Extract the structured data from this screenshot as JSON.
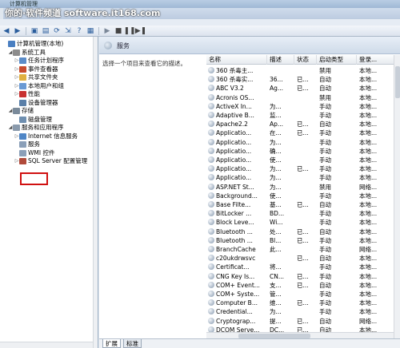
{
  "window": {
    "title": "计算机管理"
  },
  "watermark": "你的·软件频道 software.it168.com",
  "toolbar": {
    "buttons": [
      "back-arrow-icon",
      "forward-arrow-icon",
      "up-folder-icon",
      "console-tree-icon",
      "refresh-icon",
      "export-icon",
      "help-icon",
      "properties-icon",
      "play-icon",
      "stop-icon",
      "pause-icon",
      "restart-icon"
    ]
  },
  "tree": {
    "items": [
      {
        "label": "计算机管理(本地)",
        "level": 0,
        "expander": "",
        "icon": "computer-icon",
        "color": "#4a7fc1"
      },
      {
        "label": "系统工具",
        "level": 1,
        "expander": "◢",
        "icon": "tools-icon",
        "color": "#8c8c8c"
      },
      {
        "label": "任务计划程序",
        "level": 2,
        "expander": "▷",
        "icon": "clock-icon",
        "color": "#5b8cc8"
      },
      {
        "label": "事件查看器",
        "level": 2,
        "expander": "▷",
        "icon": "event-viewer-icon",
        "color": "#c84c2e"
      },
      {
        "label": "共享文件夹",
        "level": 2,
        "expander": "▷",
        "icon": "shared-folder-icon",
        "color": "#e0b040"
      },
      {
        "label": "本地用户和组",
        "level": 2,
        "expander": "▷",
        "icon": "users-icon",
        "color": "#6a9ad4"
      },
      {
        "label": "性能",
        "level": 2,
        "expander": "▷",
        "icon": "performance-icon",
        "color": "#c83030"
      },
      {
        "label": "设备管理器",
        "level": 2,
        "expander": "",
        "icon": "device-manager-icon",
        "color": "#5a7fa8"
      },
      {
        "label": "存储",
        "level": 1,
        "expander": "◢",
        "icon": "storage-icon",
        "color": "#7a8a9a"
      },
      {
        "label": "磁盘管理",
        "level": 2,
        "expander": "",
        "icon": "disk-icon",
        "color": "#6f8fb0"
      },
      {
        "label": "服务和应用程序",
        "level": 1,
        "expander": "◢",
        "icon": "services-apps-icon",
        "color": "#8a9aac"
      },
      {
        "label": "Internet 信息服务",
        "level": 2,
        "expander": "▷",
        "icon": "iis-icon",
        "color": "#4f86c6"
      },
      {
        "label": "服务",
        "level": 2,
        "expander": "",
        "icon": "services-gear-icon",
        "color": "#8a9fb8"
      },
      {
        "label": "WMI 控件",
        "level": 2,
        "expander": "",
        "icon": "wmi-icon",
        "color": "#8a9fb8"
      },
      {
        "label": "SQL Server 配置管理",
        "level": 2,
        "expander": "▷",
        "icon": "sql-server-icon",
        "color": "#b04a3a"
      }
    ]
  },
  "pane": {
    "header": "服务",
    "description": "选择一个项目来查看它的描述。",
    "columns": [
      "名称",
      "描述",
      "状态",
      "启动类型",
      "登录..."
    ],
    "rows": [
      [
        "360 杀毒主...",
        "",
        "",
        "禁用",
        "本地..."
      ],
      [
        "360 杀毒实...",
        "36...",
        "已...",
        "自动",
        "本地..."
      ],
      [
        "ABC V3.2",
        "Ag...",
        "已...",
        "自动",
        "本地..."
      ],
      [
        "Acronis OS...",
        "",
        "",
        "禁用",
        "本地..."
      ],
      [
        "ActiveX In...",
        "为...",
        "",
        "手动",
        "本地..."
      ],
      [
        "Adaptive B...",
        "监...",
        "",
        "手动",
        "本地..."
      ],
      [
        "Apache2.2",
        "Ap...",
        "已...",
        "自动",
        "本地..."
      ],
      [
        "Applicatio...",
        "在...",
        "已...",
        "手动",
        "本地..."
      ],
      [
        "Applicatio...",
        "为...",
        "",
        "手动",
        "本地..."
      ],
      [
        "Applicatio...",
        "确...",
        "",
        "手动",
        "本地..."
      ],
      [
        "Applicatio...",
        "使...",
        "",
        "手动",
        "本地..."
      ],
      [
        "Applicatio...",
        "为...",
        "已...",
        "手动",
        "本地..."
      ],
      [
        "Applicatio...",
        "为...",
        "",
        "手动",
        "本地..."
      ],
      [
        "ASP.NET St...",
        "为...",
        "",
        "禁用",
        "网络..."
      ],
      [
        "Background...",
        "使...",
        "",
        "手动",
        "本地..."
      ],
      [
        "Base Filte...",
        "基...",
        "已...",
        "自动",
        "本地..."
      ],
      [
        "BitLocker ...",
        "BD...",
        "",
        "手动",
        "本地..."
      ],
      [
        "Block Leve...",
        "Wi...",
        "",
        "手动",
        "本地..."
      ],
      [
        "Bluetooth ...",
        "处...",
        "已...",
        "自动",
        "本地..."
      ],
      [
        "Bluetooth ...",
        "Bl...",
        "已...",
        "手动",
        "本地..."
      ],
      [
        "BranchCache",
        "此...",
        "",
        "手动",
        "网络..."
      ],
      [
        "c20ukdrwsvc",
        "",
        "已...",
        "自动",
        "本地..."
      ],
      [
        "Certificat...",
        "将...",
        "",
        "手动",
        "本地..."
      ],
      [
        "CNG Key Is...",
        "CN...",
        "已...",
        "手动",
        "本地..."
      ],
      [
        "COM+ Event...",
        "支...",
        "已...",
        "自动",
        "本地..."
      ],
      [
        "COM+ Syste...",
        "管...",
        "",
        "手动",
        "本地..."
      ],
      [
        "Computer B...",
        "维...",
        "已...",
        "手动",
        "本地..."
      ],
      [
        "Credential...",
        "为...",
        "",
        "手动",
        "本地..."
      ],
      [
        "Cryptograp...",
        "提...",
        "已...",
        "自动",
        "网络..."
      ],
      [
        "DCOM Serve...",
        "DC...",
        "已...",
        "自动",
        "本地..."
      ]
    ]
  },
  "tabs": [
    "扩展",
    "标准"
  ]
}
